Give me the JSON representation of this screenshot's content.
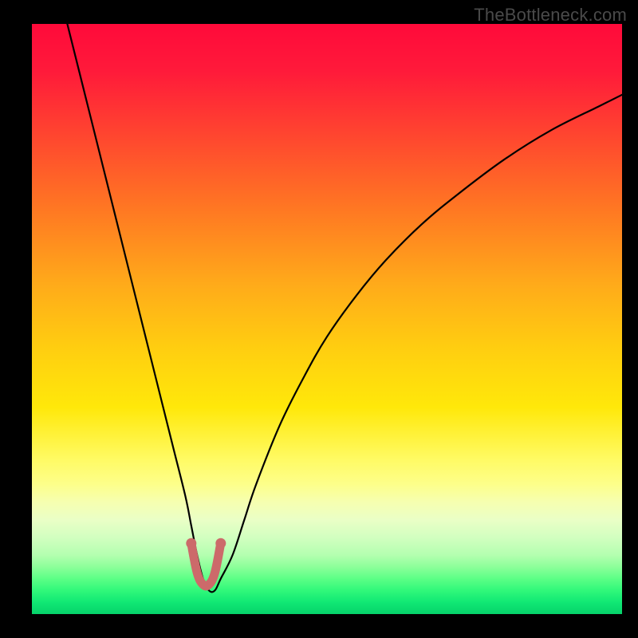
{
  "watermark": "TheBottleneck.com",
  "chart_data": {
    "type": "line",
    "title": "",
    "xlabel": "",
    "ylabel": "",
    "xlim": [
      0,
      100
    ],
    "ylim": [
      0,
      100
    ],
    "grid": false,
    "legend": false,
    "series": [
      {
        "name": "bottleneck-curve",
        "x": [
          6,
          8,
          10,
          12,
          14,
          16,
          18,
          20,
          22,
          24,
          26,
          27,
          28,
          29,
          30,
          31,
          32,
          34,
          36,
          38,
          42,
          46,
          50,
          55,
          60,
          66,
          72,
          80,
          88,
          96,
          100
        ],
        "y": [
          100,
          92,
          84,
          76,
          68,
          60,
          52,
          44,
          36,
          28,
          20,
          15,
          10,
          6,
          4,
          4,
          6,
          10,
          16,
          22,
          32,
          40,
          47,
          54,
          60,
          66,
          71,
          77,
          82,
          86,
          88
        ]
      }
    ],
    "accent_segment": {
      "name": "minimum-u",
      "color": "#cc6a6a",
      "x": [
        27,
        28,
        29,
        30,
        31,
        32
      ],
      "y": [
        12,
        7,
        5,
        5,
        7,
        12
      ]
    }
  }
}
